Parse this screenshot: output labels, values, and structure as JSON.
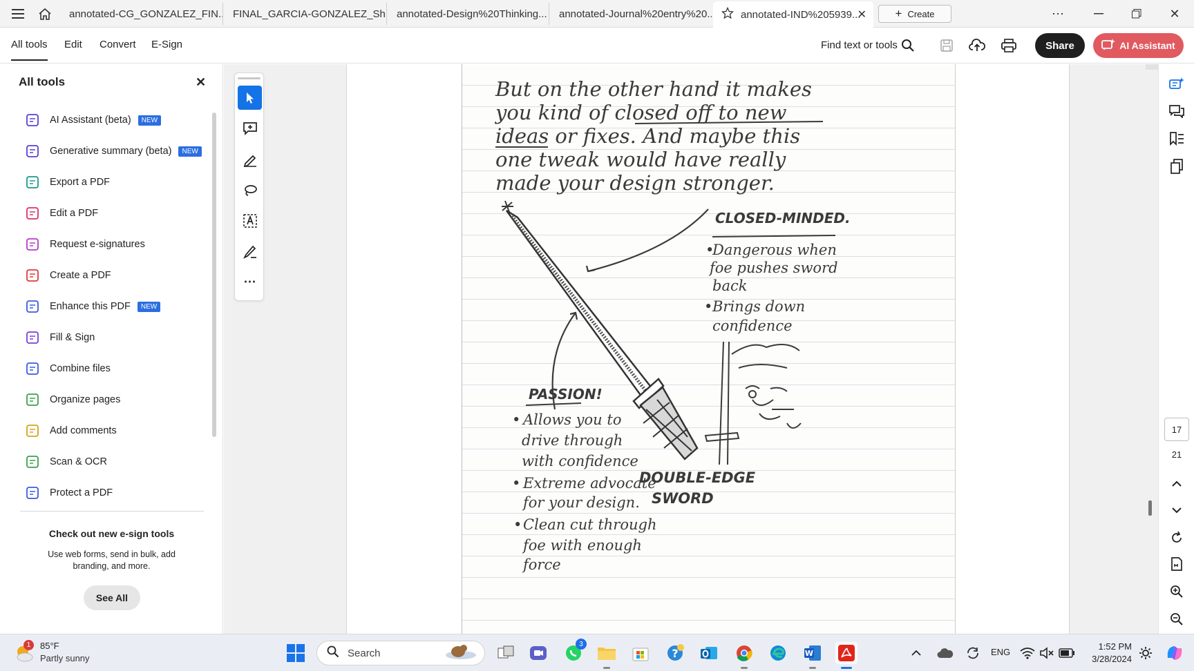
{
  "tabs": [
    {
      "label": "annotated-CG_GONZALEZ_FIN..."
    },
    {
      "label": "FINAL_GARCIA-GONZALEZ_Sh..."
    },
    {
      "label": "annotated-Design%20Thinking..."
    },
    {
      "label": "annotated-Journal%20entry%20..."
    },
    {
      "label": "annotated-IND%205939..."
    }
  ],
  "create_label": "Create",
  "menu": {
    "items": [
      "All tools",
      "Edit",
      "Convert",
      "E-Sign"
    ],
    "find_text": "Find text or tools",
    "share_label": "Share",
    "ai_label": "AI Assistant"
  },
  "left_panel": {
    "title": "All tools",
    "tools": [
      {
        "label": "AI Assistant (beta)",
        "badge": "NEW",
        "color": "#5a3fd6"
      },
      {
        "label": "Generative summary (beta)",
        "badge": "NEW",
        "color": "#5a3fd6"
      },
      {
        "label": "Export a PDF",
        "badge": "",
        "color": "#1a9a8b"
      },
      {
        "label": "Edit a PDF",
        "badge": "",
        "color": "#d6336c"
      },
      {
        "label": "Request e-signatures",
        "badge": "",
        "color": "#b33dc6"
      },
      {
        "label": "Create a PDF",
        "badge": "",
        "color": "#e03a3a"
      },
      {
        "label": "Enhance this PDF",
        "badge": "NEW",
        "color": "#3a5be0"
      },
      {
        "label": "Fill & Sign",
        "badge": "",
        "color": "#7a3fd6"
      },
      {
        "label": "Combine files",
        "badge": "",
        "color": "#3a5be0"
      },
      {
        "label": "Organize pages",
        "badge": "",
        "color": "#3aa14a"
      },
      {
        "label": "Add comments",
        "badge": "",
        "color": "#d8a21a"
      },
      {
        "label": "Scan & OCR",
        "badge": "",
        "color": "#3aa14a"
      },
      {
        "label": "Protect a PDF",
        "badge": "",
        "color": "#3a5be0"
      }
    ],
    "promo_title": "Check out new e-sign tools",
    "promo_text": "Use web forms, send in bulk, add branding, and more.",
    "see_all": "See All"
  },
  "document": {
    "text_lines": [
      "But on the other hand it makes",
      "you kind of closed off to new",
      "ideas or fixes. And maybe this",
      "one tweak would have really",
      "made your design stronger."
    ],
    "closed_title": "CLOSED-MINDED.",
    "closed_bullets": [
      "Dangerous when",
      "foe pushes sword",
      "back",
      "Brings down",
      "confidence"
    ],
    "passion_title": "PASSION!",
    "passion_bullets": [
      "Allows you to",
      "drive through",
      "with confidence",
      "Extreme advocate",
      "for your design.",
      "Clean cut through",
      "foe with enough",
      "force"
    ],
    "sword_label_1": "DOUBLE-EDGE",
    "sword_label_2": "SWORD"
  },
  "page_nav": {
    "current": "17",
    "total": "21"
  },
  "taskbar": {
    "temp": "85°F",
    "weather": "Partly sunny",
    "weather_badge": "1",
    "search_placeholder": "Search",
    "whatsapp_badge": "3",
    "lang": "ENG",
    "time": "1:52 PM",
    "date": "3/28/2024"
  }
}
